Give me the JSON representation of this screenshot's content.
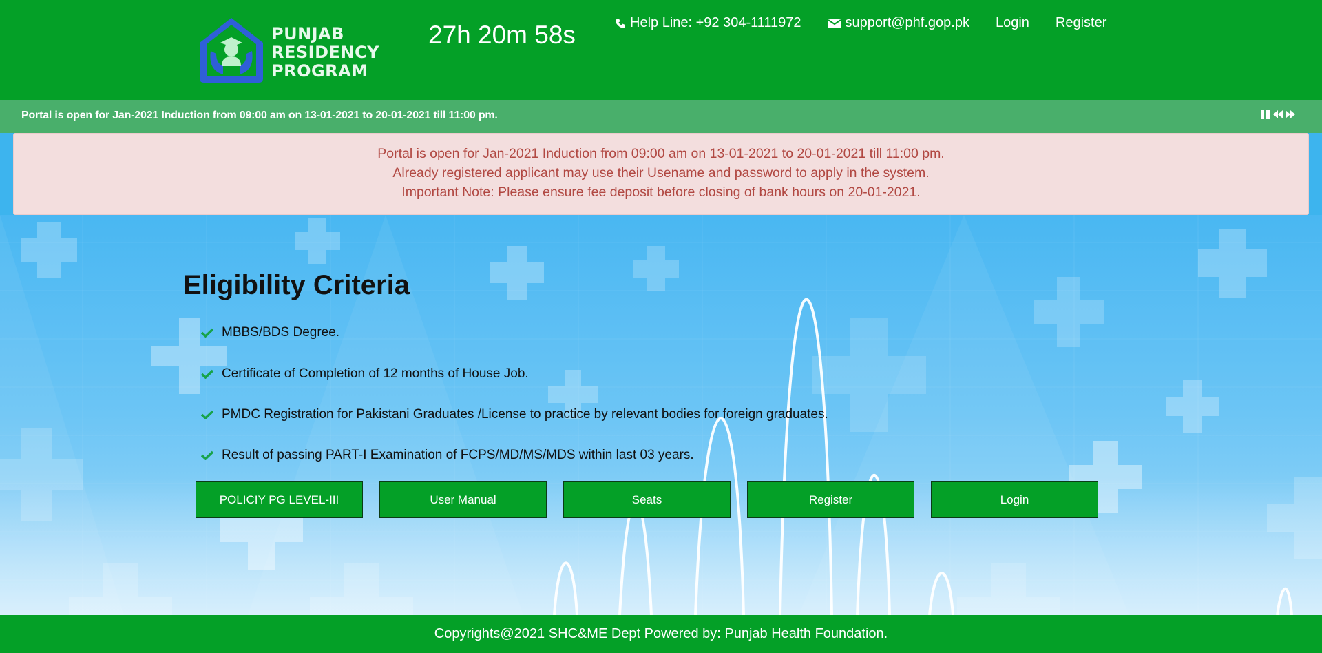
{
  "header": {
    "logo_lines": [
      "PUNJAB",
      "RESIDENCY",
      "PROGRAM"
    ],
    "timer": "27h 20m 58s",
    "helpline": "Help Line: +92 304-1111972",
    "email": "support@phf.gop.pk",
    "login": "Login",
    "register": "Register"
  },
  "ticker": {
    "text": "Portal is open for Jan-2021 Induction from 09:00 am on 13-01-2021 to 20-01-2021 till 11:00 pm."
  },
  "alert": {
    "lines": [
      "Portal is open for Jan-2021 Induction from 09:00 am on 13-01-2021 to 20-01-2021 till 11:00 pm.",
      "Already registered applicant may use their Usename and password to apply in the system.",
      "Important Note: Please ensure fee deposit before closing of bank hours on 20-01-2021."
    ]
  },
  "main": {
    "title": "Eligibility Criteria",
    "criteria": [
      "MBBS/BDS Degree.",
      "Certificate of Completion of 12 months of House Job.",
      "PMDC Registration for Pakistani Graduates /License to practice by relevant bodies for foreign graduates.",
      "Result of passing PART-I Examination of FCPS/MD/MS/MDS within last 03 years."
    ],
    "buttons": [
      "POLICIY PG LEVEL-III",
      "User Manual",
      "Seats",
      "Register",
      "Login"
    ]
  },
  "footer": {
    "text": "Copyrights@2021 SHC&ME Dept Powered by: Punjab Health Foundation."
  },
  "colors": {
    "header_green": "#04a027",
    "ticker_green": "#49af6b",
    "alert_bg": "#f3dede",
    "alert_text": "#b14842",
    "check_green": "#17a34a",
    "sky_blue": "#49b7f2"
  }
}
